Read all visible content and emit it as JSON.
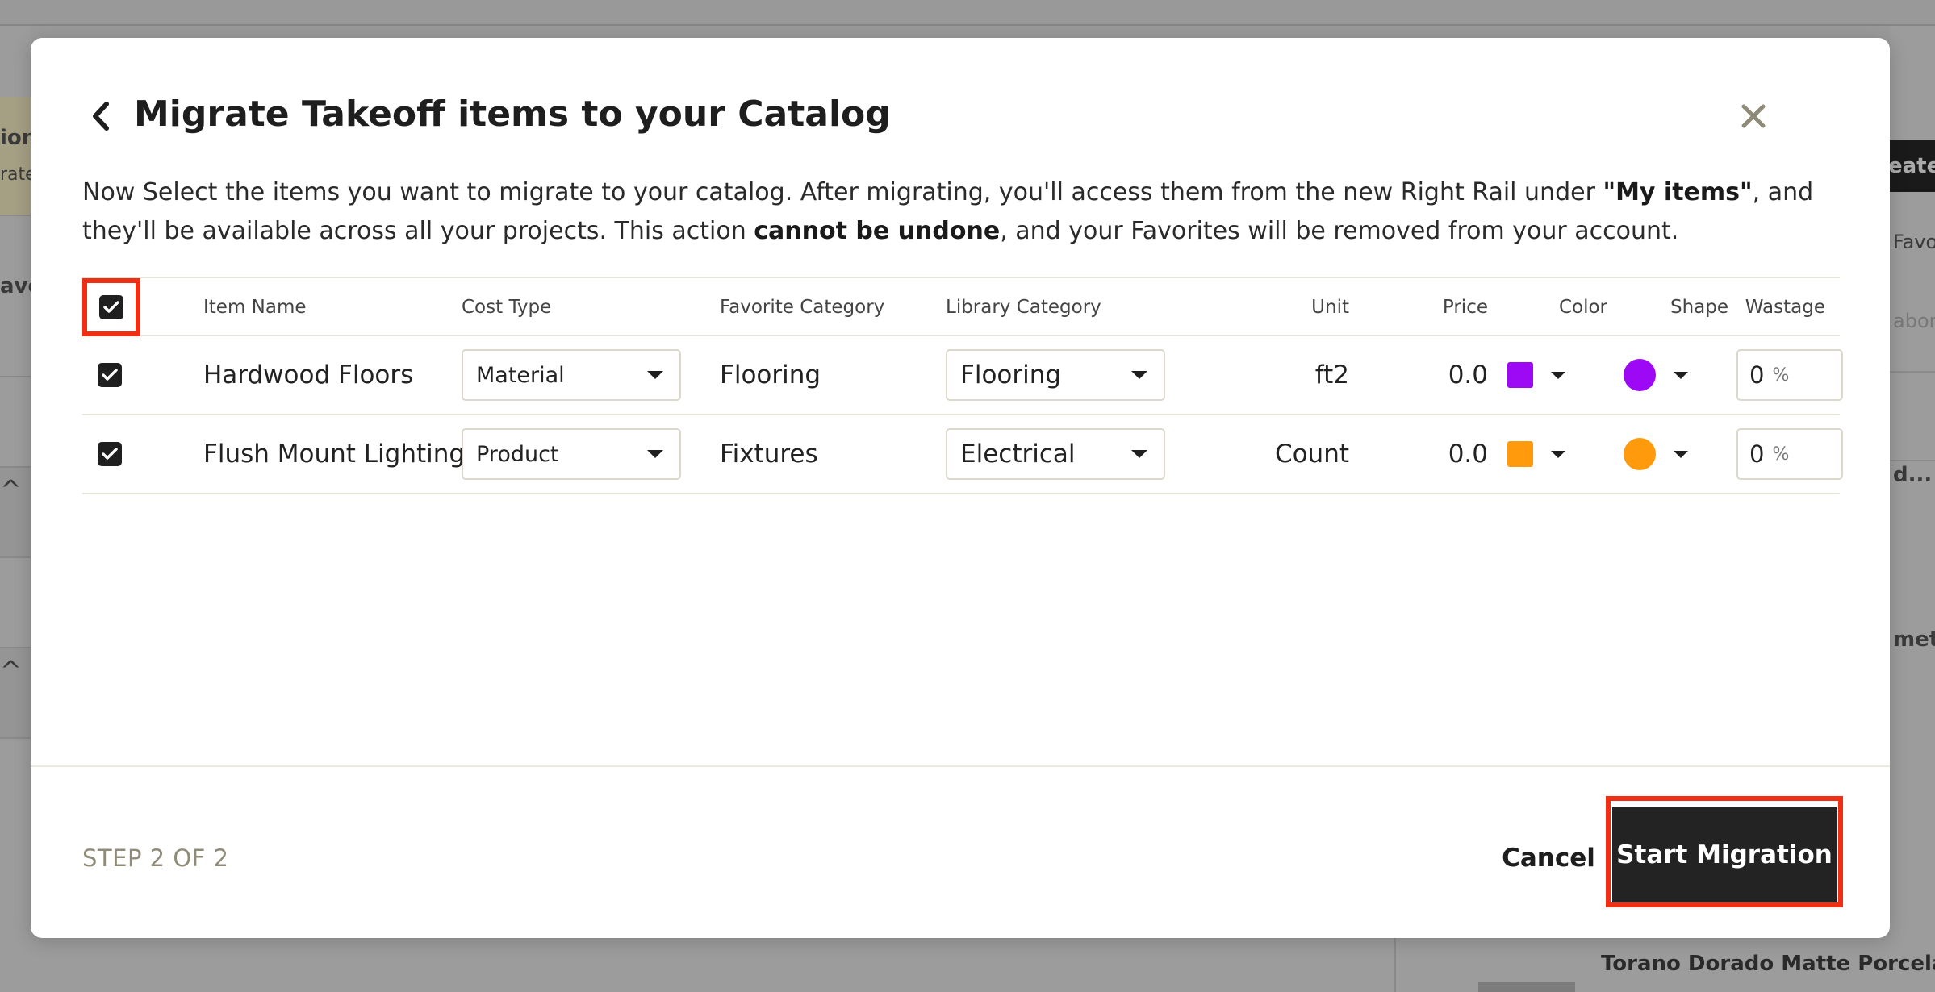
{
  "background": {
    "left_texts": [
      "ion",
      "rate",
      "avo"
    ],
    "right_texts": [
      "Favo",
      "abor",
      "d...",
      "metr"
    ],
    "create_label": "eate",
    "bottom_item": "Torano Dorado Matte Porcelain W"
  },
  "modal": {
    "title": "Migrate Takeoff items to your Catalog",
    "description": {
      "part1": "Now Select the items you want to migrate to your catalog. After migrating, you'll access them from the new Right Rail under ",
      "bold1": "\"My items\"",
      "part2": ", and they'll be available across all your projects. This action ",
      "bold2": "cannot be undone",
      "part3": ", and your Favorites will be removed from your account."
    },
    "table": {
      "headers": {
        "item_name": "Item Name",
        "cost_type": "Cost Type",
        "favorite_category": "Favorite Category",
        "library_category": "Library Category",
        "unit": "Unit",
        "price": "Price",
        "color": "Color",
        "shape": "Shape",
        "wastage": "Wastage"
      },
      "rows": [
        {
          "item_name": "Hardwood Floors",
          "cost_type": "Material",
          "favorite_category": "Flooring",
          "library_category": "Flooring",
          "unit": "ft2",
          "price": "0.0",
          "color": "#9d08f5",
          "shape_color": "#9d08f5",
          "wastage": "0",
          "wastage_unit": "%"
        },
        {
          "item_name": "Flush Mount Lighting",
          "cost_type": "Product",
          "favorite_category": "Fixtures",
          "library_category": "Electrical",
          "unit": "Count",
          "price": "0.0",
          "color": "#ff9a0d",
          "shape_color": "#ff9a0d",
          "wastage": "0",
          "wastage_unit": "%"
        }
      ]
    },
    "footer": {
      "step": "STEP 2 OF 2",
      "cancel_label": "Cancel",
      "start_label": "Start Migration"
    }
  },
  "colors": {
    "highlight": "#ef2e13",
    "primary_button": "#232323"
  }
}
